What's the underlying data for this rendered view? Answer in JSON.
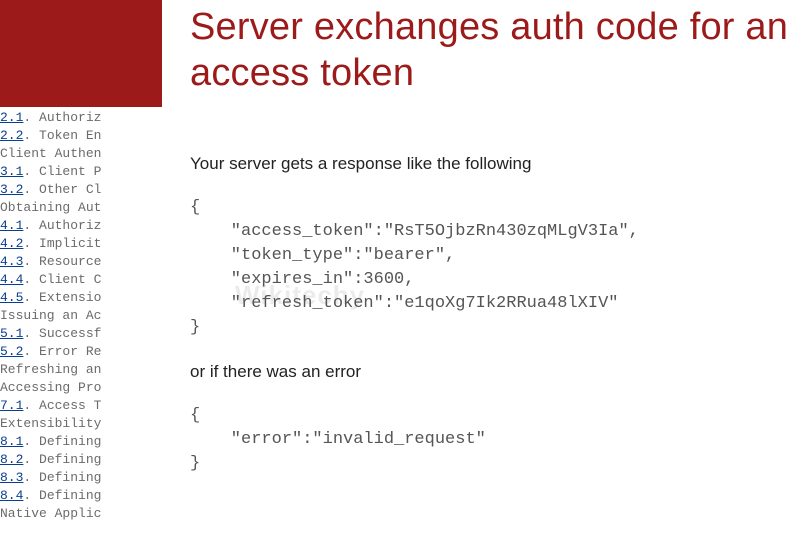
{
  "colors": {
    "accent": "#9d1a1a",
    "link": "#0a3f8f"
  },
  "watermark": "Wikitechy",
  "toc": [
    {
      "num": "2.1",
      "label": "Authoriz",
      "indent": 0,
      "cut": true
    },
    {
      "num": "2.2",
      "label": "Token En",
      "indent": 0
    },
    {
      "num": "",
      "label": "Client Authen",
      "indent": 1
    },
    {
      "num": "3.1",
      "label": "Client P",
      "indent": 0
    },
    {
      "num": "3.2",
      "label": "Other Cl",
      "indent": 0
    },
    {
      "num": "",
      "label": "Obtaining Aut",
      "indent": 1
    },
    {
      "num": "4.1",
      "label": "Authoriz",
      "indent": 0
    },
    {
      "num": "4.2",
      "label": "Implicit",
      "indent": 0
    },
    {
      "num": "4.3",
      "label": "Resource",
      "indent": 0
    },
    {
      "num": "4.4",
      "label": "Client C",
      "indent": 0
    },
    {
      "num": "4.5",
      "label": "Extensio",
      "indent": 0
    },
    {
      "num": "",
      "label": "Issuing an Ac",
      "indent": 1
    },
    {
      "num": "5.1",
      "label": "Successf",
      "indent": 0
    },
    {
      "num": "5.2",
      "label": "Error Re",
      "indent": 0
    },
    {
      "num": "",
      "label": "Refreshing an",
      "indent": 1
    },
    {
      "num": "",
      "label": "Accessing Pro",
      "indent": 1
    },
    {
      "num": "7.1",
      "label": "Access T",
      "indent": 0
    },
    {
      "num": "",
      "label": "Extensibility",
      "indent": 1
    },
    {
      "num": "8.1",
      "label": "Defining",
      "indent": 0
    },
    {
      "num": "8.2",
      "label": "Defining",
      "indent": 0
    },
    {
      "num": "8.3",
      "label": "Defining",
      "indent": 0
    },
    {
      "num": "8.4",
      "label": "Defining",
      "indent": 0
    },
    {
      "num": "",
      "label": "Native Applic",
      "indent": 1
    }
  ],
  "main": {
    "title": "Server exchanges auth code for an access token",
    "intro": "Your server gets a response like the following",
    "code1_lines": [
      "{",
      "    \"access_token\":\"RsT5OjbzRn430zqMLgV3Ia\",",
      "    \"token_type\":\"bearer\",",
      "    \"expires_in\":3600,",
      "    \"refresh_token\":\"e1qoXg7Ik2RRua48lXIV\"",
      "}"
    ],
    "mid": "or if there was an error",
    "code2_lines": [
      "{",
      "    \"error\":\"invalid_request\"",
      "}"
    ]
  }
}
